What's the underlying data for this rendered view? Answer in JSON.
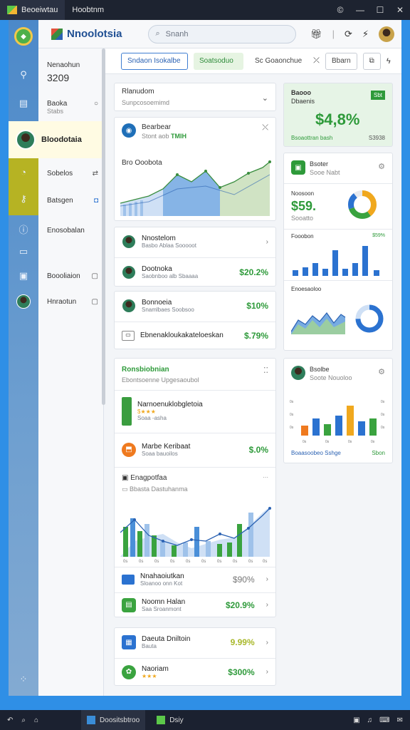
{
  "titlebar": {
    "tab1": "Beoeiwtau",
    "tab2": "Hoobtnm",
    "controls": [
      "©",
      "—",
      "☐",
      "✕"
    ]
  },
  "header": {
    "brand": "Nnoolotsia",
    "search_placeholder": "Snanh"
  },
  "sidebar": {
    "top_item": {
      "label": "Nenaohun",
      "value": "3209"
    },
    "items": [
      {
        "label": "Baoka",
        "sub": "Stabs"
      },
      {
        "label": "Sobelos"
      },
      {
        "label": "Batsgen"
      },
      {
        "label": "Enosobalan"
      },
      {
        "label": "Boooliaion"
      },
      {
        "label": "Hnraotun"
      }
    ],
    "active_item": "Bloodotaia"
  },
  "toolbar": {
    "btn_primary": "Sndaon Isokalbe",
    "btn_green": "Soatsoduo",
    "btn_plain": "Sc Goaonchue",
    "btn_box": "Bbarn"
  },
  "left": {
    "filter": {
      "title": "Rlanudom",
      "sub": "Sunpcosoemimd"
    },
    "chart_card": {
      "title": "Bearbear",
      "sub": "Stont  aob",
      "badge": "TMIH",
      "caption": "Bro Ooobota"
    },
    "list1": [
      {
        "title": "Nnostelom",
        "sub": "Basbo  Ablaa  Sooooot"
      },
      {
        "title": "Dootnoka",
        "sub": "Saobnboo  alb Sbaaaa",
        "amount": "$20.2%"
      }
    ],
    "list2": [
      {
        "title": "Bonnoeia",
        "sub": "Snamlbaes  Soobsoo",
        "amount": "$10%"
      },
      {
        "title": "Ebnenakloukakateloeskan",
        "amount": "$.79%"
      }
    ],
    "section": {
      "title": "Ronsbiobnian",
      "sub": "Ebontsoenne  Upgesaoubol"
    },
    "list3": [
      {
        "title": "Narnoenuklobgletoia",
        "stars": "$★★★",
        "sub": "Soaa  -asha"
      },
      {
        "title": "Marbe Keribaat",
        "sub": "Soaa  bauoilos",
        "amount": "$.0%"
      }
    ],
    "chart2": {
      "title": "Enagpotfaa",
      "sub": "Bbasta  Dastuhanma"
    },
    "list4": [
      {
        "title": "Nnahaoiutkan",
        "sub": "Sloanoo  onn  Kot",
        "amount": "$90%"
      },
      {
        "title": "Noomn Halan",
        "sub": "Saa  Sroanmont",
        "amount": "$20.9%"
      }
    ],
    "list5": [
      {
        "title": "Daeuta Dniltoin",
        "sub": "Bauta",
        "amount": "9.99%"
      },
      {
        "title": "Naoriam",
        "stars": "★★★",
        "amount": "$300%"
      }
    ]
  },
  "right": {
    "kpi": {
      "title": "Baooo",
      "sub": "Dbaenis",
      "badge": "Sbt",
      "value": "$4,8%",
      "foot": "Bsoaottran bash",
      "foot_value": "S3938"
    },
    "card2": {
      "title": "Bsoter",
      "sub": "Sooe  Nabt",
      "donut_label": "Noosoon",
      "donut_value": "$59.",
      "donut_sub": "Sooatto",
      "bar_label": "Fooobon",
      "bar_badge": "$59%",
      "line_label": "Enoesaoloo"
    },
    "card3": {
      "title": "Bsolbe",
      "sub": "Soote  Nouoloo",
      "foot": "Boaasoobeo  Sshge",
      "foot_badge": "Sbon"
    }
  },
  "chart_data": [
    {
      "type": "area",
      "name": "top-area",
      "values": [
        3,
        5,
        6,
        8,
        5,
        7,
        8,
        6,
        7,
        10,
        11,
        13
      ]
    },
    {
      "type": "bar",
      "name": "right-bars",
      "values": [
        2,
        4,
        5,
        3,
        9,
        3,
        4,
        10,
        2
      ]
    },
    {
      "type": "area",
      "name": "right-lines",
      "values": [
        2,
        5,
        3,
        6,
        4,
        7,
        3,
        6
      ]
    },
    {
      "type": "bar",
      "name": "right-bars-2",
      "values": [
        2,
        5,
        3,
        6,
        7,
        9,
        4,
        5
      ]
    },
    {
      "type": "bar",
      "name": "bottom-mixed",
      "values": [
        7,
        9,
        6,
        8,
        5,
        4,
        3,
        5,
        9,
        4,
        3,
        5,
        8,
        10
      ]
    }
  ],
  "taskbar": {
    "app1": "Doositsbtroo",
    "app2": "Dsiy",
    "tray": [
      "▣",
      "♫",
      "⌨",
      "✉"
    ]
  }
}
